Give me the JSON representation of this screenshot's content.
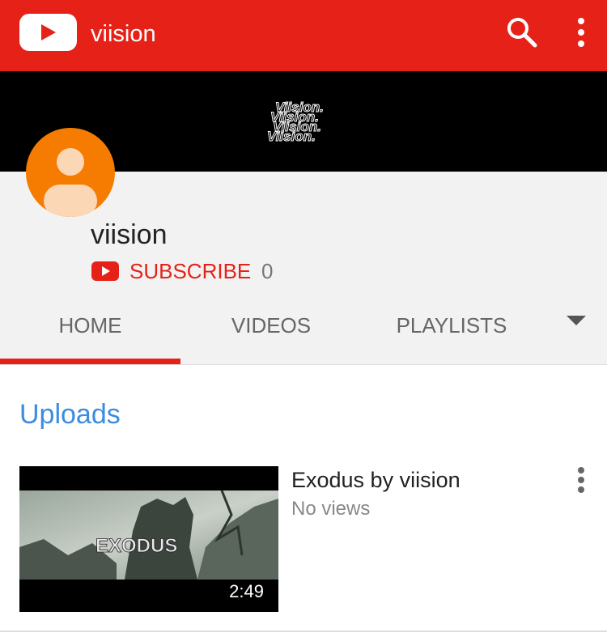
{
  "app_bar": {
    "title": "viision",
    "logo_icon": "youtube-logo-icon",
    "search_icon": "search-icon",
    "more_icon": "more-vert-icon",
    "color": "#e62117"
  },
  "banner": {
    "text": "Viision."
  },
  "channel": {
    "name": "viision",
    "avatar_color": "#f57c00",
    "subscribe_label": "SUBSCRIBE",
    "subscriber_count": "0"
  },
  "tabs": [
    {
      "label": "HOME",
      "active": true
    },
    {
      "label": "VIDEOS",
      "active": false
    },
    {
      "label": "PLAYLISTS",
      "active": false
    }
  ],
  "uploads": {
    "section_title": "Uploads",
    "videos": [
      {
        "thumbnail_text": "EXODUS",
        "duration": "2:49",
        "title": "Exodus by viision",
        "views": "No views"
      }
    ]
  }
}
